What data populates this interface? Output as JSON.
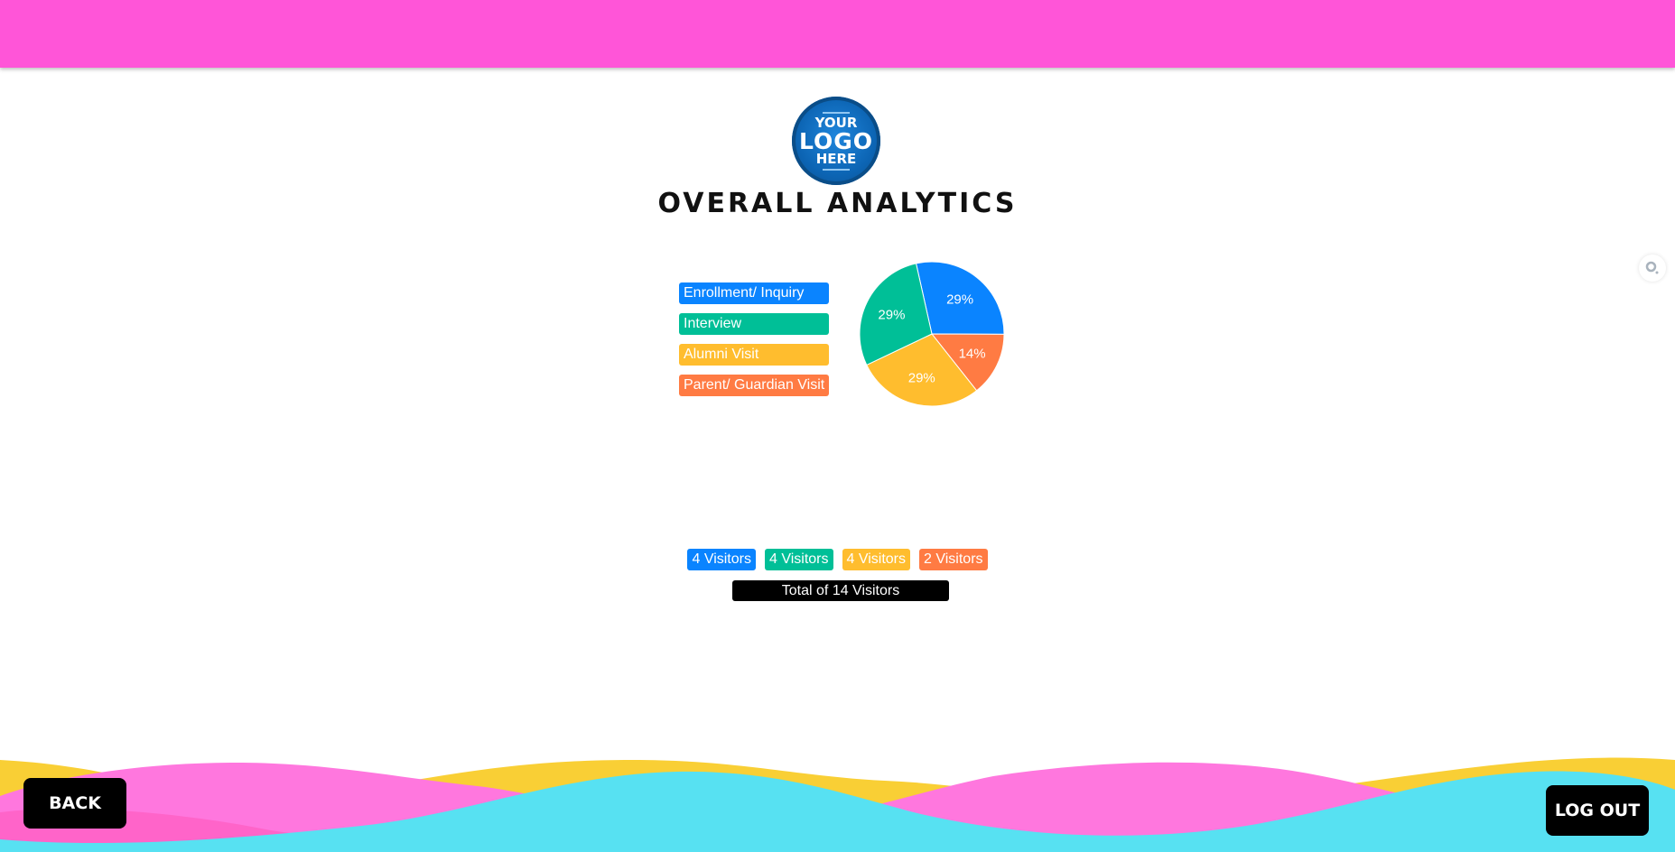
{
  "header": {
    "bar_color": "#ff55d8"
  },
  "logo": {
    "line1": "YOUR",
    "line2": "LOGO",
    "line3": "HERE"
  },
  "page_title": "OVERALL ANALYTICS",
  "chart_data": {
    "type": "pie",
    "categories": [
      "Enrollment/ Inquiry",
      "Interview",
      "Alumni Visit",
      "Parent/ Guardian Visit"
    ],
    "values": [
      4,
      4,
      4,
      2
    ],
    "labels": [
      "29%",
      "29%",
      "29%",
      "14%"
    ],
    "colors": [
      "#0a84ff",
      "#00bf97",
      "#ffbd2e",
      "#ff7b43"
    ],
    "legend_position": "left"
  },
  "visitor_counts": [
    "4 Visitors",
    "4 Visitors",
    "4 Visitors",
    "2 Visitors"
  ],
  "total_label": "Total of 14 Visitors",
  "buttons": {
    "back": "BACK",
    "logout": "LOG OUT"
  },
  "icons": {
    "side": "search-icon"
  }
}
